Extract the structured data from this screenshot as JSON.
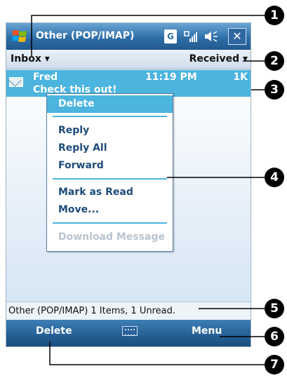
{
  "titlebar": {
    "title": "Other (POP/IMAP)",
    "sync_glyph": "G",
    "icons": [
      "windows-start-icon",
      "sync-icon",
      "signal-icon",
      "volume-icon",
      "close-icon"
    ],
    "close_glyph": "✕"
  },
  "header": {
    "folder": "Inbox ▾",
    "sort": "Received ▾"
  },
  "message": {
    "sender": "Fred",
    "time": "11:19 PM",
    "size": "1K",
    "subject": "Check this out!"
  },
  "menu": {
    "delete": "Delete",
    "reply": "Reply",
    "reply_all": "Reply All",
    "forward": "Forward",
    "mark_read": "Mark as Read",
    "move": "Move...",
    "download": "Download Message"
  },
  "status": {
    "text": "Other (POP/IMAP)  1 Items, 1 Unread."
  },
  "softkeys": {
    "left": "Delete",
    "right": "Menu"
  },
  "callouts": [
    "1",
    "2",
    "3",
    "4",
    "5",
    "6",
    "7"
  ],
  "colors": {
    "titlebar": "#2d6ea8",
    "highlight": "#4bb4df",
    "softkey": "#245d92",
    "callout": "#000000"
  }
}
